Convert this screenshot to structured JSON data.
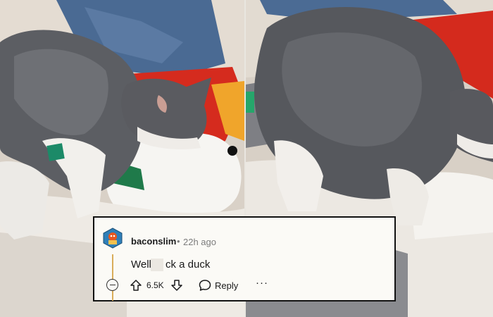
{
  "comment": {
    "username": "baconslim",
    "separator": "•",
    "time": "22h ago",
    "body_before": "Well",
    "body_after": "ck a duck",
    "score": "6.5K",
    "reply_label": "Reply",
    "more_label": "···"
  },
  "icons": [
    "avatar-icon",
    "collapse-icon",
    "upvote-icon",
    "downvote-icon",
    "reply-icon",
    "more-icon"
  ],
  "colors": {
    "card_background": "#fbfaf6",
    "card_border": "#111111",
    "thread_line": "#d9ad5a",
    "avatar_blue": "#2f7fb8",
    "avatar_orange": "#e8571f"
  }
}
